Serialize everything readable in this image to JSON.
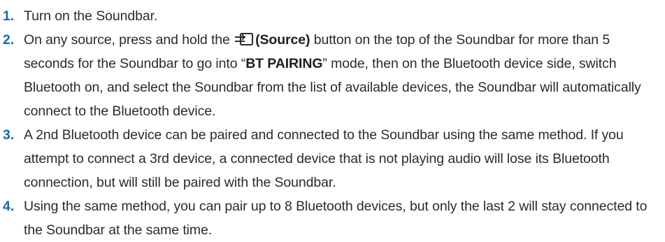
{
  "steps": [
    {
      "number": "1.",
      "text": "Turn on the Soundbar."
    },
    {
      "number": "2.",
      "text_before_icon": "On any source, press and hold the ",
      "icon": "source-input-icon",
      "bold_label": "(Source)",
      "text_after_label": " button on the top of the Soundbar for more than 5 seconds for the Soundbar to go into “",
      "bold_mode": "BT PAIRING",
      "text_end": "” mode, then on the Bluetooth device side, switch Bluetooth on, and select the Soundbar from the list of available devices, the Soundbar will automatically connect to the Bluetooth device."
    },
    {
      "number": "3.",
      "text": "A 2nd Bluetooth device can be paired and connected to the Soundbar using the same method. If you attempt to connect a 3rd device, a connected device that is not playing audio will lose its Bluetooth connection, but will still be paired with the Soundbar."
    },
    {
      "number": "4.",
      "text": "Using the same method, you can pair up to 8 Bluetooth devices, but only the last 2 will stay connected to the Soundbar at the same time."
    }
  ],
  "colors": {
    "step_number": "#1a66b8",
    "body_text": "#2b2b2b"
  }
}
